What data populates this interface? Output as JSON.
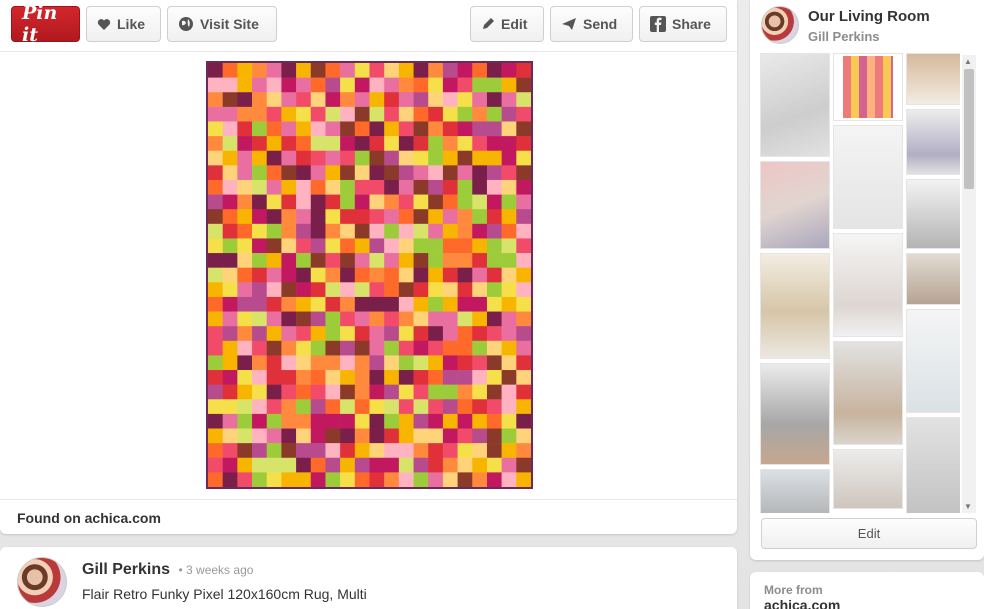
{
  "toolbar": {
    "pinit_label": "Pin it",
    "like_label": "Like",
    "visit_label": "Visit Site",
    "edit_label": "Edit",
    "send_label": "Send",
    "share_label": "Share"
  },
  "pin": {
    "image_icon": "pixel-rug-image",
    "found_on": "Found on achica.com"
  },
  "comment": {
    "author": "Gill Perkins",
    "time": "• 3 weeks ago",
    "description": "Flair Retro Funky Pixel 120x160cm Rug, Multi"
  },
  "board": {
    "title": "Our Living Room",
    "owner": "Gill Perkins",
    "edit_label": "Edit"
  },
  "more_from": {
    "label": "More from",
    "site": "achica.com"
  },
  "colors": {
    "pinit_red": "#c8232c",
    "rug_border": "#6b2a5a"
  }
}
